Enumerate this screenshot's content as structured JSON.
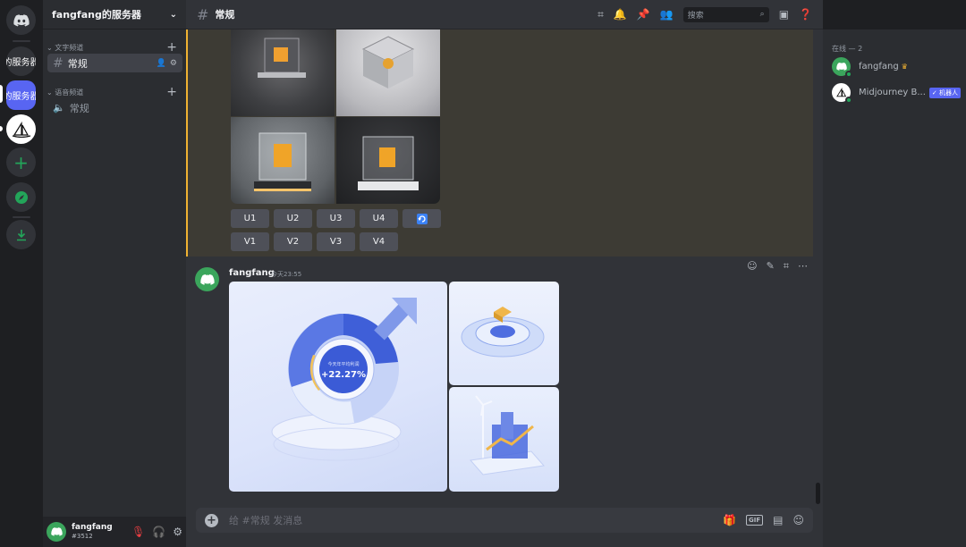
{
  "server_rail": {
    "items": [
      {
        "name": "discord-home",
        "label": ""
      },
      {
        "name": "server-1",
        "label": "的服务器"
      },
      {
        "name": "server-2",
        "label": "的服务器"
      },
      {
        "name": "midjourney",
        "label": ""
      },
      {
        "name": "add-server",
        "label": "+"
      },
      {
        "name": "explore",
        "label": ""
      },
      {
        "name": "download",
        "label": ""
      }
    ]
  },
  "sidebar": {
    "server_name": "fangfang的服务器",
    "text_category": "文字频道",
    "voice_category": "语音频道",
    "text_channel": "常规",
    "voice_channel": "常规"
  },
  "user": {
    "name": "fangfang",
    "tag": "#3512"
  },
  "topbar": {
    "channel": "常规",
    "search_placeholder": "搜索"
  },
  "mj_buttons": {
    "row1": [
      "U1",
      "U2",
      "U3",
      "U4"
    ],
    "row2": [
      "V1",
      "V2",
      "V3",
      "V4"
    ]
  },
  "message": {
    "author": "fangfang",
    "time": "今天23:55",
    "image_text_small": "今天年平均利润",
    "image_text_big": "+22.27%"
  },
  "composer": {
    "placeholder": "给 #常规 发消息",
    "gif": "GIF"
  },
  "members": {
    "heading": "在线 — 2",
    "list": [
      {
        "name": "fangfang",
        "badge": ""
      },
      {
        "name": "Midjourney B...",
        "badge": "✓ 机器人"
      }
    ]
  },
  "colors": {
    "accent": "#5865f2",
    "online": "#23a55a",
    "highlight_border": "#f0b232"
  }
}
